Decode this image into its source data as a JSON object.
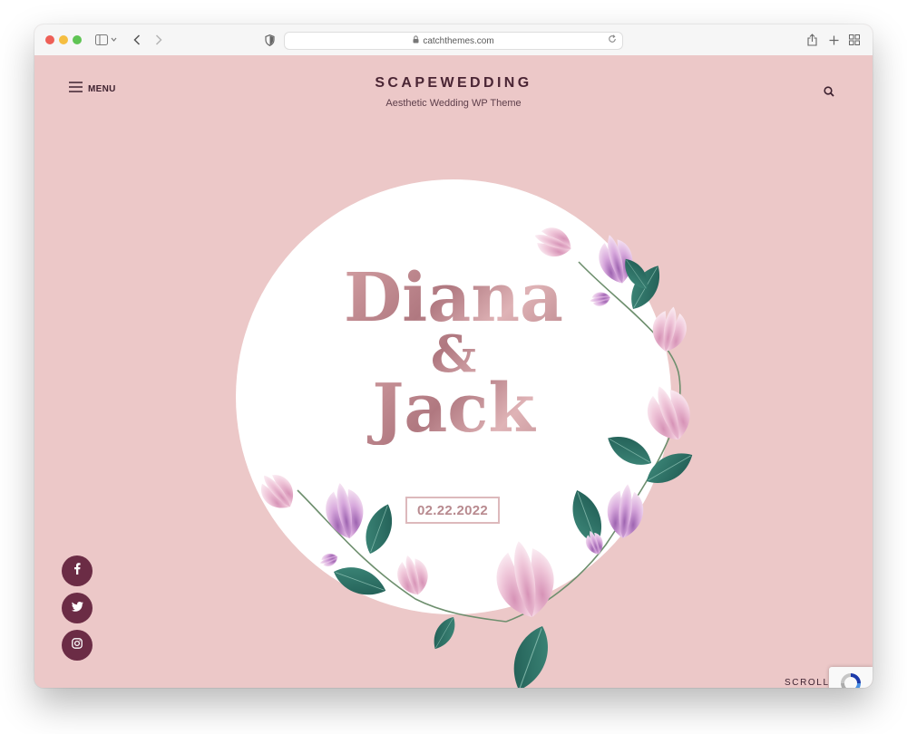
{
  "browser": {
    "url": "catchthemes.com"
  },
  "header": {
    "menu_label": "MENU",
    "site_title": "SCAPEWEDDING",
    "tagline": "Aesthetic Wedding WP Theme"
  },
  "hero": {
    "name1": "Diana",
    "ampersand": "&",
    "name2": "Jack",
    "date": "02.22.2022"
  },
  "social": [
    {
      "network": "facebook",
      "icon": "facebook-icon"
    },
    {
      "network": "twitter",
      "icon": "twitter-icon"
    },
    {
      "network": "instagram",
      "icon": "instagram-icon"
    }
  ],
  "scroll_label": "SCROLL",
  "colors": {
    "page_bg": "#ecc8c8",
    "title": "#4a2534",
    "social_bg": "#6b2c45",
    "name_gradient_dark": "#b07880",
    "name_gradient_light": "#dfb3b6",
    "leaf": "#2f6f64",
    "flower": "#c99bd3"
  }
}
